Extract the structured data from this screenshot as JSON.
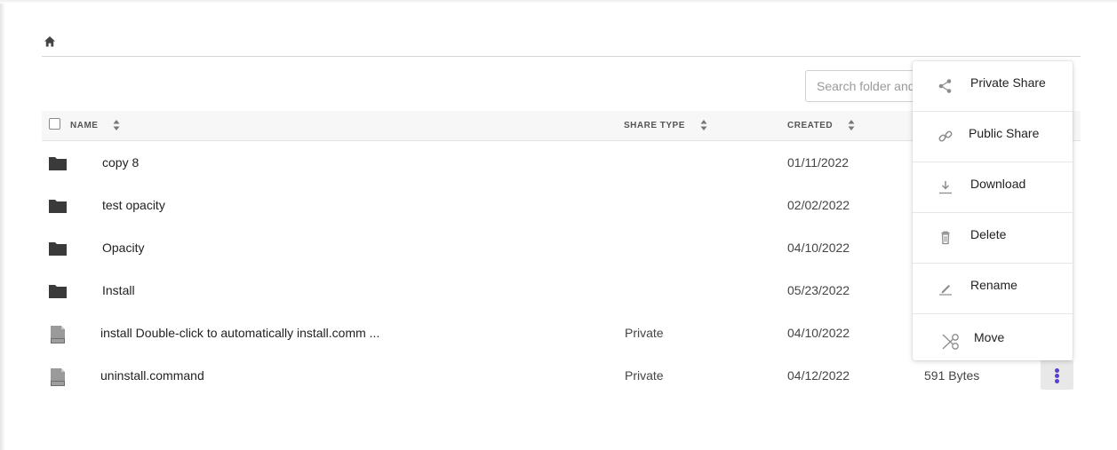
{
  "breadcrumb": {
    "home_icon": "home-icon"
  },
  "search": {
    "placeholder": "Search folder and"
  },
  "table": {
    "columns": {
      "name": "NAME",
      "share_type": "SHARE TYPE",
      "created": "CREATED"
    },
    "rows": [
      {
        "type": "folder",
        "name": "copy 8",
        "share_type": "",
        "created": "01/11/2022",
        "size": ""
      },
      {
        "type": "folder",
        "name": "test opacity",
        "share_type": "",
        "created": "02/02/2022",
        "size": ""
      },
      {
        "type": "folder",
        "name": "Opacity",
        "share_type": "",
        "created": "04/10/2022",
        "size": ""
      },
      {
        "type": "folder",
        "name": "Install",
        "share_type": "",
        "created": "05/23/2022",
        "size": ""
      },
      {
        "type": "file",
        "name": "install Double-click to automatically install.comm ...",
        "share_type": "Private",
        "created": "04/10/2022",
        "size": ""
      },
      {
        "type": "file",
        "name": "uninstall.command",
        "share_type": "Private",
        "created": "04/12/2022",
        "size": "591 Bytes"
      }
    ]
  },
  "context_menu": {
    "items": [
      {
        "label": "Private Share",
        "icon": "share-icon"
      },
      {
        "label": "Public Share",
        "icon": "link-icon"
      },
      {
        "label": "Download",
        "icon": "download-icon"
      },
      {
        "label": "Delete",
        "icon": "trash-icon"
      },
      {
        "label": "Rename",
        "icon": "pencil-icon"
      },
      {
        "label": "Move",
        "icon": "scissors-icon"
      }
    ]
  },
  "colors": {
    "accent": "#5b3fd1",
    "icon_dark": "#3a3a3a",
    "icon_muted": "#9a9a9a"
  }
}
